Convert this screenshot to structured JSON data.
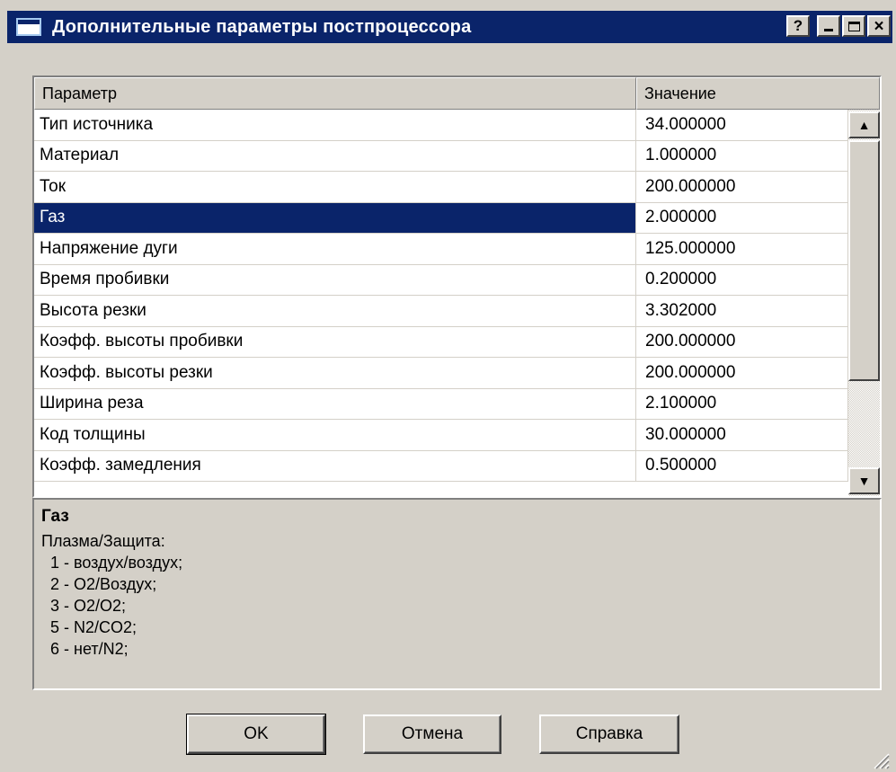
{
  "window": {
    "title": "Дополнительные параметры постпроцессора",
    "buttons": {
      "help": "?",
      "minimize": "minimize",
      "maximize": "maximize",
      "close": "×"
    }
  },
  "grid": {
    "headers": {
      "param": "Параметр",
      "value": "Значение"
    },
    "rows": [
      {
        "param": "Тип источника",
        "value": "34.000000"
      },
      {
        "param": "Материал",
        "value": "1.000000"
      },
      {
        "param": "Ток",
        "value": "200.000000"
      },
      {
        "param": "Газ",
        "value": "2.000000",
        "selected": true
      },
      {
        "param": "Напряжение дуги",
        "value": "125.000000"
      },
      {
        "param": "Время пробивки",
        "value": "0.200000"
      },
      {
        "param": "Высота резки",
        "value": "3.302000"
      },
      {
        "param": "Коэфф. высоты пробивки",
        "value": "200.000000"
      },
      {
        "param": "Коэфф. высоты резки",
        "value": "200.000000"
      },
      {
        "param": "Ширина реза",
        "value": "2.100000"
      },
      {
        "param": "Код толщины",
        "value": "30.000000"
      },
      {
        "param": "Коэфф. замедления",
        "value": "0.500000"
      }
    ]
  },
  "description": {
    "title": "Газ",
    "lines": [
      "Плазма/Защита:",
      "  1 - воздух/воздух;",
      "  2 - O2/Воздух;",
      "  3 - O2/O2;",
      "  5 - N2/CO2;",
      "  6 - нет/N2;"
    ]
  },
  "buttons": {
    "ok": "OK",
    "cancel": "Отмена",
    "help": "Справка"
  },
  "colors": {
    "face": "#d4d0c8",
    "titlebar": "#0a246a",
    "selection": "#0a246a"
  },
  "icons": {
    "scroll_up": "arrow-up-icon",
    "scroll_down": "arrow-down-icon",
    "resize": "resize-grip-icon"
  }
}
